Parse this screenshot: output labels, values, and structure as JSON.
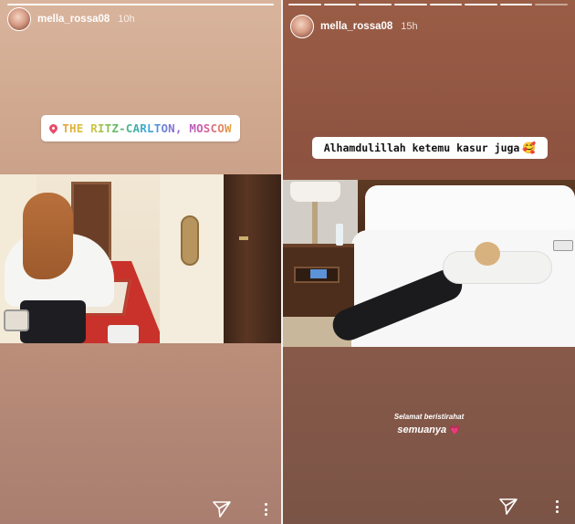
{
  "left_story": {
    "username": "mella_rossa08",
    "time": "10h",
    "location_sticker": "THE RITZ-CARLTON, MOSCOW",
    "progress_segments": 1,
    "progress_done": 1
  },
  "right_story": {
    "username": "mella_rossa08",
    "time": "15h",
    "caption": "Alhamdulillah ketemu kasur juga",
    "caption_emoji": "🥰",
    "closing_line1": "Selamat beristirahat",
    "closing_line2": "semuanya",
    "closing_emoji": "💗",
    "progress_segments": 8,
    "progress_done": 7
  },
  "icons": {
    "send": "paper-plane-icon",
    "more": "vertical-dots-icon",
    "location": "location-pin-icon"
  },
  "colors": {
    "left_background": "#caa088",
    "right_background": "#8d5340",
    "sticker_background": "#ffffff"
  }
}
